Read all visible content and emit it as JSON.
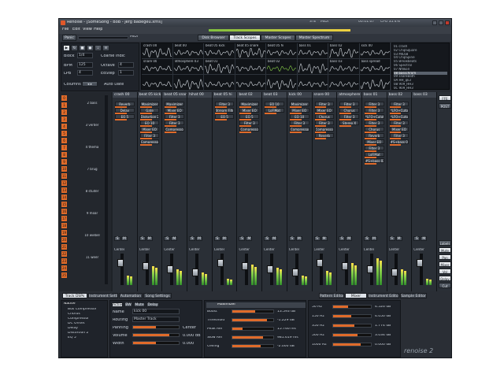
{
  "window": {
    "title": "Renoise - [SomeSong - BoB - Jerg Babegeu.xrns]",
    "cpu": "CPU 35.4%",
    "time": "00:01:07",
    "stereo": "STE",
    "midi": "MIDI"
  },
  "menu": [
    "File",
    "Edit",
    "View",
    "Help"
  ],
  "top_toggles": {
    "panic": "Panic",
    "midi": "MIDI",
    "views": [
      "Disk Browser",
      "Track Scopes",
      "Master Scopes",
      "Master Spectrum"
    ],
    "active_view": "Track Scopes"
  },
  "toolbar": {
    "block_label": "Block",
    "block_value": "1/4",
    "coarse_label": "Coarse indic",
    "bpm_label": "BPM",
    "bpm_value": "125",
    "lpb_label": "LPB",
    "lpb_value": "4",
    "octave_label": "Octave",
    "octave_value": "4",
    "edstep_label": "EdStep",
    "edstep_value": "1",
    "columns_label": "Columns",
    "autodate_label": "Auto Date"
  },
  "pattern_grid": [
    [
      "crash 00",
      "beat 00",
      "beat 05 kick",
      "beat 05 snare",
      "beat 05 hi",
      "bass 01",
      "bass 02",
      "kick 00"
    ],
    [
      "snare 00",
      "atmosphere 03",
      "beat 01",
      "",
      "beat 02",
      "",
      "bass 03",
      "bass spread"
    ],
    [
      "",
      "",
      "",
      "",
      "",
      "",
      "",
      ""
    ]
  ],
  "instruments": [
    "01 crash",
    "02 ChipSquare",
    "03 MIL68",
    "04 ChipSpine",
    "05 Breakbeats",
    "06 Spectral",
    "07 Nfilkoll",
    "08 basschrom",
    "09 snareBath",
    "0A HH_qk3",
    "0B 909_HH3",
    "0C 909_HH3"
  ],
  "selected_instrument_index": 7,
  "tracks": [
    {
      "name": "crash 00",
      "fx": [
        "Reverb",
        "Delay",
        "EQ 5"
      ],
      "db": "0.000 dB",
      "route": "Master"
    },
    {
      "name": "beat 05 kick",
      "fx": [
        "Maximizer",
        "Gate",
        "Distortion 2",
        "EQ 10",
        "Mixer EQ",
        "Filter 3",
        "Compressor"
      ],
      "db": "0.000 dB",
      "route": "Master"
    },
    {
      "name": "beat 05 snare",
      "fx": [
        "Maximizer",
        "Mixer EQ",
        "Filter 3",
        "Filter 3",
        "Compressor"
      ],
      "db": "0.000 dB",
      "route": "Master"
    },
    {
      "name": "hihat 00",
      "fx": [],
      "db": "-1.732 dB",
      "route": "Master"
    },
    {
      "name": "beat 05 hi",
      "fx": [
        "Filter 3",
        "Stream Filter",
        "EQ 5"
      ],
      "db": "0.000 dB",
      "route": "Master"
    },
    {
      "name": "beat 02",
      "fx": [
        "Maximizer",
        "Mixer EQ",
        "EQ 5",
        "Filter 3",
        "Compressor"
      ],
      "db": "0.000 dB",
      "route": "Master"
    },
    {
      "name": "beat 03",
      "fx": [
        "EQ 10",
        "LoFiMat"
      ],
      "db": "0.000 dB",
      "route": "Master"
    },
    {
      "name": "kick 00",
      "fx": [
        "Maximizer",
        "Mixer EQ",
        "EQ 10",
        "Filter 3",
        "Compressor"
      ],
      "db": "0.000 dB",
      "route": "Master"
    },
    {
      "name": "snare 00",
      "fx": [
        "Filter 3",
        "Mixer EQ",
        "Chorus",
        "Filter 3",
        "Compressor",
        "Reverb"
      ],
      "db": "0.000 dB",
      "route": "Master"
    },
    {
      "name": "atmosphere 03",
      "fx": [
        "Filter 3",
        "Chorus",
        "Filter 3",
        "Stereo X"
      ],
      "db": "0.000 dB",
      "route": "Master"
    },
    {
      "name": "bass 01",
      "fx": [
        "Filter 3",
        "Filter 3",
        "*LFO+Cutoff",
        "Filter 3",
        "Chorus",
        "Reverb",
        "Mixer EQ",
        "Filter 3",
        "LoFiMat",
        "#S+bass 02"
      ],
      "db": "0.000 dB",
      "route": "Master"
    },
    {
      "name": "bass 02",
      "fx": [
        "Filter 3",
        "*LFO+Cutoff",
        "*LFO+Cutoff",
        "Filter 3",
        "Mixer EQ",
        "Filter 3",
        "#S+bass 01"
      ],
      "db": "0.000 dB",
      "route": "Master"
    },
    {
      "name": "bass 03",
      "fx": [],
      "db": "0.000 dB",
      "route": "Analog F"
    }
  ],
  "sequencer": {
    "labels": [
      "2 bass",
      "3 verder",
      "4 thema",
      "7 brug",
      "8 stuiter",
      "9 moar",
      "10 wiebel",
      "11 weer"
    ]
  },
  "right_col": {
    "top": [
      "FFE",
      "POST"
    ],
    "bottom": [
      "Labels",
      "Mute",
      "Pan",
      "Mixer",
      "Vol",
      "Delay",
      "Cut"
    ]
  },
  "bottom": {
    "left_tabs": [
      "Track DSPs",
      "Instrument Settings",
      "Automation",
      "Song Settings"
    ],
    "right_tabs": [
      "Pattern Editor",
      "Mixer",
      "Instrument Editor",
      "Sample Editor"
    ],
    "active_left": "Track DSPs",
    "active_right": "Mixer",
    "dsp_list_title": "Native",
    "dsp_list": [
      "Bus Compressor",
      "Chorus",
      "Compressor",
      "DC Offset",
      "Delay",
      "Distortion 2",
      "EQ 5"
    ],
    "device_header": [
      "Active",
      "BW",
      "Mute",
      "Delay"
    ],
    "track_name_label": "Name",
    "track_name": "kick 00",
    "routing_label": "Routing",
    "routing": "Master Track",
    "panning_label": "Panning",
    "panning": "Center",
    "volume_label": "Volume",
    "volume": "0.000 dB",
    "width_label": "Width",
    "width": "0.000",
    "maximizer_title": "Maximizer",
    "maximizer_params": [
      {
        "label": "Boost",
        "value": "13.593 dB",
        "level": 0.55
      },
      {
        "label": "Threshold",
        "value": "-1.229 dB",
        "level": 0.85
      },
      {
        "label": "Peak Rel",
        "value": "15.746 ms",
        "level": 0.25
      },
      {
        "label": "Slow Rel",
        "value": "981.619 ms",
        "level": 0.75
      },
      {
        "label": "Ceiling",
        "value": "-2.000 dB",
        "level": 0.7
      }
    ],
    "eq_rows": [
      {
        "freq": "50 Hz",
        "value": "4.526 dB"
      },
      {
        "freq": "150 Hz",
        "value": "4.050 dB"
      },
      {
        "freq": "350 Hz",
        "value": "1.774 dB"
      },
      {
        "freq": "500 Hz",
        "value": "3.034 dB"
      },
      {
        "freq": "1000 Hz",
        "value": "0.000 dB"
      }
    ],
    "logo": "renoise 2"
  },
  "colors": {
    "accent": "#e06b2a",
    "background": "#2b3038",
    "meter_green": "#8ad14a"
  }
}
